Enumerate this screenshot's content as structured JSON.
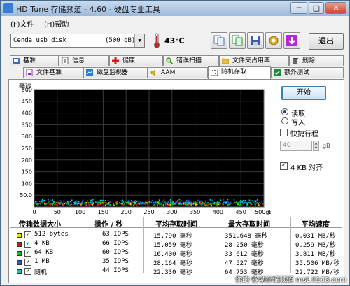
{
  "window": {
    "title": "HD Tune 存储频道 - 4.60 - 硬盘专业工具",
    "watermark_overlay": "你的·移动存储频道 mst.it168.com",
    "minimize_glyph": "─",
    "maximize_glyph": "□",
    "close_glyph": "✕"
  },
  "menu": {
    "file": "(F)文件",
    "help": "(H)帮助"
  },
  "toolbar": {
    "drive_name": "Cenda   usb disk",
    "drive_size": "(500 gB)",
    "temperature": "43℃",
    "exit_label": "退出"
  },
  "tabs_top": [
    "基准",
    "信息",
    "健康",
    "错误扫描",
    "文件夹占用率",
    "删除"
  ],
  "tabs_bottom": [
    "文件基准",
    "磁盘监视器",
    "AAM",
    "随机存取",
    "额外测试"
  ],
  "active_tab": "随机存取",
  "chart": {
    "y_unit": "毫秒",
    "y_ticks": [
      "500",
      "450",
      "400",
      "350",
      "300",
      "250",
      "200",
      "150",
      "100",
      "50.0"
    ],
    "x_ticks": [
      "0",
      "50",
      "100",
      "150",
      "200",
      "250",
      "300",
      "350",
      "400",
      "450",
      "500gB"
    ]
  },
  "chart_data": {
    "type": "scatter",
    "title": "",
    "xlabel": "",
    "ylabel": "毫秒",
    "xlim": [
      0,
      500
    ],
    "ylim": [
      0,
      500
    ],
    "x_unit": "gB",
    "grid": true,
    "background": "#000000",
    "series": [
      {
        "name": "512 bytes",
        "color": "#e8e800",
        "y_range": [
          10,
          22
        ]
      },
      {
        "name": "4 KB",
        "color": "#e01010",
        "y_range": [
          10,
          22
        ]
      },
      {
        "name": "64 KB",
        "color": "#10c010",
        "y_range": [
          10,
          24
        ]
      },
      {
        "name": "1 MB",
        "color": "#1060e0",
        "y_range": [
          14,
          32
        ]
      },
      {
        "name": "随机",
        "color": "#00d8e8",
        "y_range": [
          14,
          34
        ]
      }
    ]
  },
  "side": {
    "start_label": "开始",
    "read_label": "读取",
    "write_label": "写入",
    "quick_label": "快捷行程",
    "quick_value": "40",
    "quick_unit": "gB",
    "align_label": "4 KB 对齐"
  },
  "table": {
    "headers": [
      "传输数据大小",
      "操作 / 秒",
      "平均存取时间",
      "最大存取时间",
      "平均速度"
    ],
    "rows": [
      {
        "size": "512 bytes",
        "color": "#f0e000",
        "ops": "63 IOPS",
        "avg": "15.790 毫秒",
        "max": "351.648 毫秒",
        "speed": "0.031 MB/秒"
      },
      {
        "size": "4 KB",
        "color": "#e01010",
        "ops": "66 IOPS",
        "avg": "15.059 毫秒",
        "max": "28.250 毫秒",
        "speed": "0.259 MB/秒"
      },
      {
        "size": "64 KB",
        "color": "#10c010",
        "ops": "60 IOPS",
        "avg": "16.400 毫秒",
        "max": "33.612 毫秒",
        "speed": "3.811 MB/秒"
      },
      {
        "size": "1 MB",
        "color": "#1060e0",
        "ops": "35 IOPS",
        "avg": "28.164 毫秒",
        "max": "47.527 毫秒",
        "speed": "35.506 MB/秒"
      },
      {
        "size": "随机",
        "color": "#00c8d8",
        "ops": "44 IOPS",
        "avg": "22.330 毫秒",
        "max": "64.753 毫秒",
        "speed": "22.722 MB/秒"
      }
    ]
  }
}
